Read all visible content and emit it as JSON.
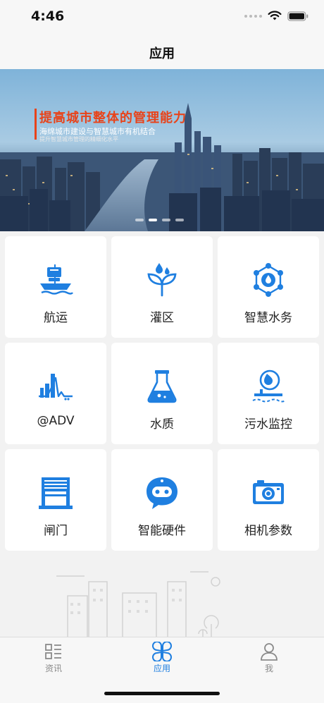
{
  "status": {
    "time": "4:46"
  },
  "nav": {
    "title": "应用"
  },
  "banner": {
    "headline": "提高城市整体的管理能力",
    "subline": "海绵城市建设与智慧城市有机结合",
    "caption": "提升智慧城市管理的精细化水平",
    "page_index": 2,
    "page_count": 4
  },
  "tiles": [
    {
      "label": "航运",
      "icon": "ship-icon"
    },
    {
      "label": "灌区",
      "icon": "sprout-icon"
    },
    {
      "label": "智慧水务",
      "icon": "water-network-icon"
    },
    {
      "label": "@ADV",
      "icon": "chart-wave-icon"
    },
    {
      "label": "水质",
      "icon": "flask-icon"
    },
    {
      "label": "污水监控",
      "icon": "sewage-icon"
    },
    {
      "label": "闸门",
      "icon": "gate-icon"
    },
    {
      "label": "智能硬件",
      "icon": "robot-icon"
    },
    {
      "label": "相机参数",
      "icon": "camera-icon"
    }
  ],
  "tabs": [
    {
      "label": "资讯",
      "icon": "news-icon",
      "active": false
    },
    {
      "label": "应用",
      "icon": "apps-icon",
      "active": true
    },
    {
      "label": "我",
      "icon": "person-icon",
      "active": false
    }
  ],
  "colors": {
    "accent": "#1f7fe0",
    "banner_headline": "#e8431a",
    "inactive": "#8a8a8a"
  }
}
